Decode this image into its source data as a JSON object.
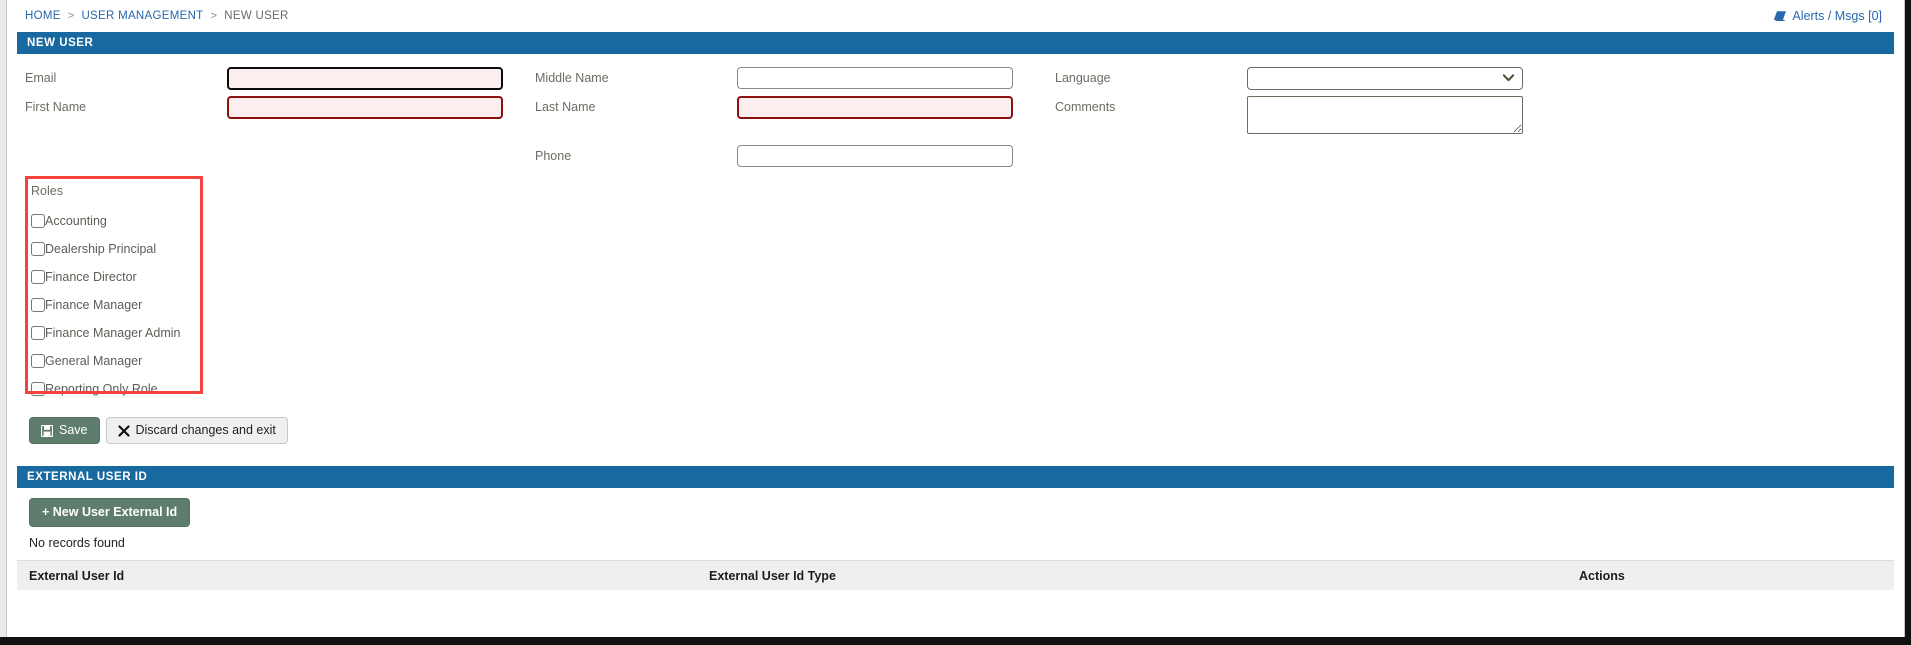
{
  "breadcrumb": {
    "items": [
      {
        "label": "HOME",
        "type": "link"
      },
      {
        "label": "USER MANAGEMENT",
        "type": "link"
      },
      {
        "label": "NEW USER",
        "type": "current"
      }
    ],
    "separator": ">"
  },
  "header": {
    "alerts_label": "Alerts / Msgs [0]",
    "alerts_icon": "book-icon"
  },
  "new_user_panel": {
    "title": "NEW USER",
    "fields": {
      "email": {
        "label": "Email",
        "value": "",
        "placeholder": "",
        "state": "focused-required"
      },
      "first_name": {
        "label": "First Name",
        "value": "",
        "placeholder": "",
        "state": "required"
      },
      "middle_name": {
        "label": "Middle Name",
        "value": "",
        "placeholder": "",
        "state": "normal"
      },
      "last_name": {
        "label": "Last Name",
        "value": "",
        "placeholder": "",
        "state": "required"
      },
      "phone": {
        "label": "Phone",
        "value": "",
        "placeholder": "",
        "state": "normal"
      },
      "language": {
        "label": "Language",
        "value": "",
        "options": [
          ""
        ],
        "state": "normal"
      },
      "comments": {
        "label": "Comments",
        "value": "",
        "placeholder": "",
        "state": "normal"
      }
    },
    "roles": {
      "title": "Roles",
      "items": [
        {
          "label": "Accounting",
          "checked": false
        },
        {
          "label": "Dealership Principal",
          "checked": false
        },
        {
          "label": "Finance Director",
          "checked": false
        },
        {
          "label": "Finance Manager",
          "checked": false
        },
        {
          "label": "Finance Manager Admin",
          "checked": false
        },
        {
          "label": "General Manager",
          "checked": false
        },
        {
          "label": "Reporting Only Role",
          "checked": false
        }
      ]
    },
    "actions": {
      "save_label": "Save",
      "save_icon": "floppy-disk-icon",
      "discard_label": "Discard changes and exit",
      "discard_icon": "x-icon"
    }
  },
  "external_user_id_panel": {
    "title": "EXTERNAL USER ID",
    "new_button_label": "+ New User External Id",
    "empty_message": "No records found",
    "columns": [
      "External User Id",
      "External User Id Type",
      "Actions"
    ],
    "rows": []
  },
  "colors": {
    "panel_header": "#17699f",
    "link": "#2767ad",
    "required_border": "#8c1111",
    "required_bg": "#fceeee",
    "focus_border": "#0b0b0b",
    "annotation": "#f4423c",
    "button_green": "#5f7d6d",
    "table_header_bg": "#efefef"
  }
}
